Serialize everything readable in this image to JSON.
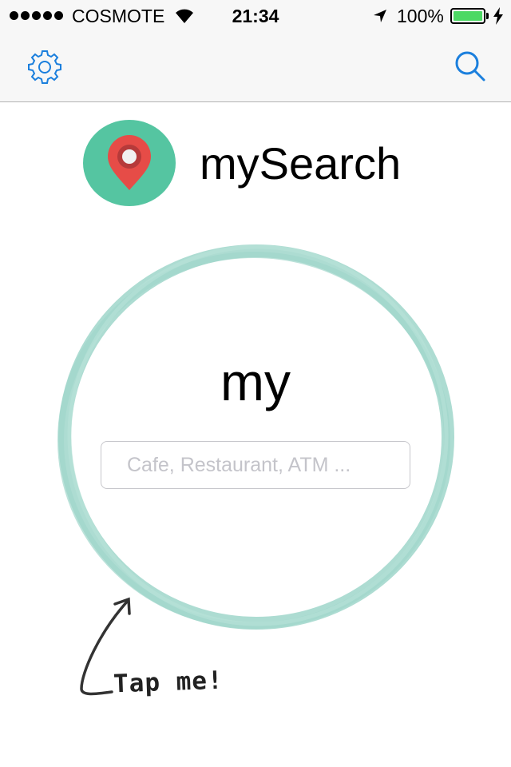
{
  "status_bar": {
    "carrier": "COSMOTE",
    "time": "21:34",
    "battery_percent": "100%",
    "battery_level": 1.0
  },
  "nav": {
    "left_icon": "gear-icon",
    "right_icon": "search-icon",
    "tint_color": "#1b7fdd"
  },
  "header": {
    "title": "mySearch",
    "logo_icon": "map-pin-icon",
    "logo_bg_color": "#55c5a1",
    "pin_color": "#e64c47"
  },
  "main": {
    "circle_label": "my",
    "circle_color": "#9fd6ca",
    "search": {
      "placeholder": "Cafe, Restaurant, ATM ...",
      "value": ""
    },
    "hint": "Tap me!"
  }
}
